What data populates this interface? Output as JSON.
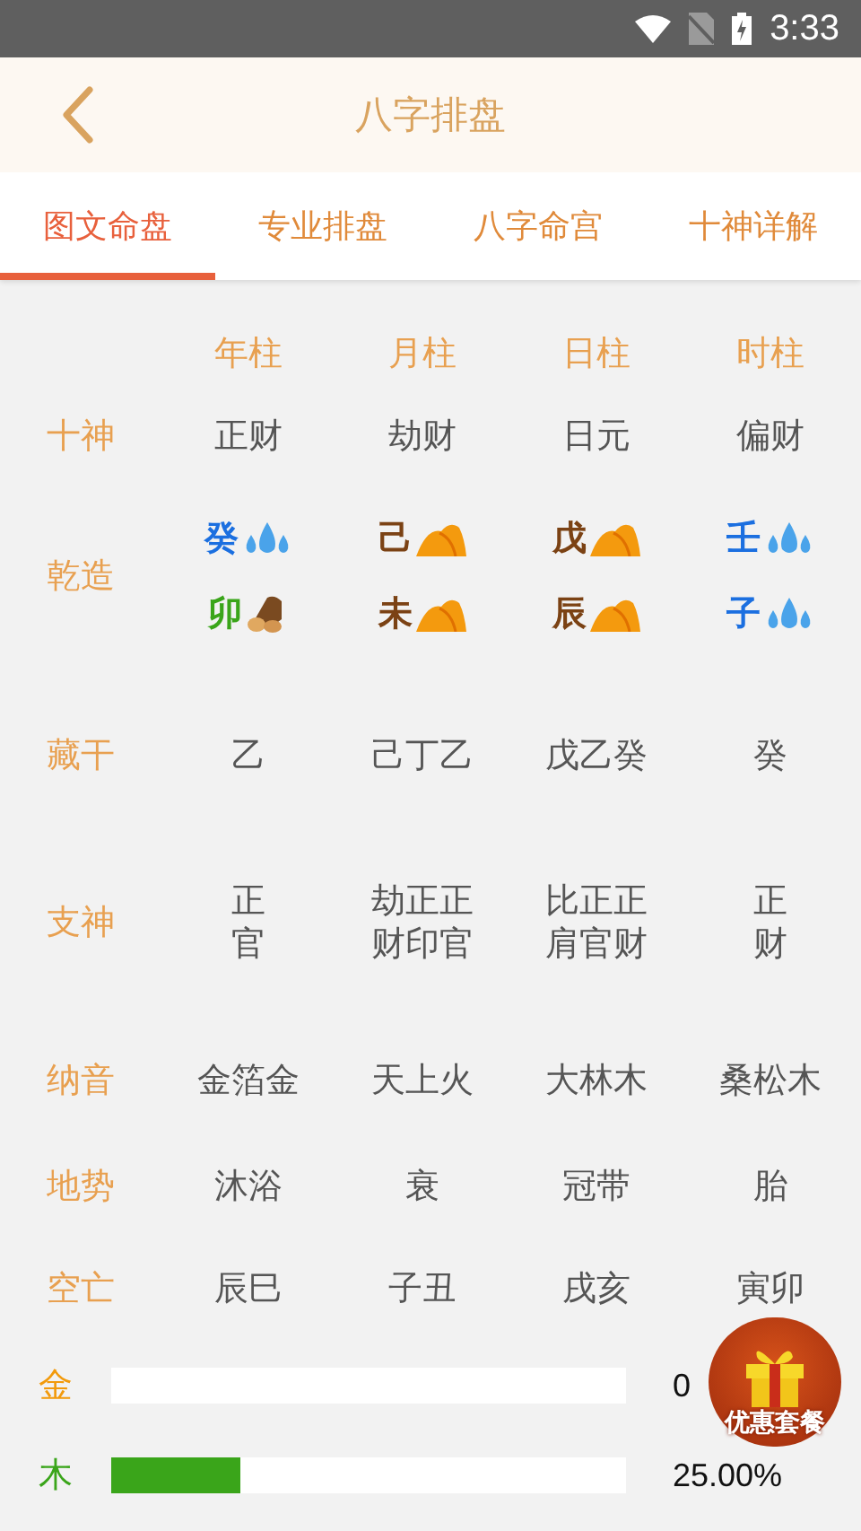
{
  "status_bar": {
    "time": "3:33"
  },
  "header": {
    "title": "八字排盘"
  },
  "tabs": [
    {
      "label": "图文命盘",
      "selected": true
    },
    {
      "label": "专业排盘",
      "selected": false
    },
    {
      "label": "八字命宫",
      "selected": false
    },
    {
      "label": "十神详解",
      "selected": false
    }
  ],
  "columns": [
    "年柱",
    "月柱",
    "日柱",
    "时柱"
  ],
  "shishen": {
    "label": "十神",
    "values": [
      "正财",
      "劫财",
      "日元",
      "偏财"
    ]
  },
  "qianzao": {
    "label": "乾造",
    "stems": [
      {
        "char": "癸",
        "kind": "water",
        "color": "#1b6fe0"
      },
      {
        "char": "己",
        "kind": "earth",
        "color": "#7b4214"
      },
      {
        "char": "戊",
        "kind": "earth",
        "color": "#7b4214"
      },
      {
        "char": "壬",
        "kind": "water",
        "color": "#1b6fe0"
      }
    ],
    "branches": [
      {
        "char": "卯",
        "kind": "wood",
        "color": "#3aa51a"
      },
      {
        "char": "未",
        "kind": "earth",
        "color": "#7b4214"
      },
      {
        "char": "辰",
        "kind": "earth",
        "color": "#7b4214"
      },
      {
        "char": "子",
        "kind": "water",
        "color": "#1b6fe0"
      }
    ]
  },
  "rows": [
    {
      "label": "藏干",
      "kind": "plain",
      "values": [
        "乙",
        "己丁乙",
        "戊乙癸",
        "癸"
      ]
    },
    {
      "label": "支神",
      "kind": "stacked",
      "values": [
        "正官",
        "劫正正财印官",
        "比正正肩官财",
        "正财"
      ]
    },
    {
      "label": "纳音",
      "kind": "plain",
      "values": [
        "金箔金",
        "天上火",
        "大林木",
        "桑松木"
      ]
    },
    {
      "label": "地势",
      "kind": "plain",
      "values": [
        "沐浴",
        "衰",
        "冠带",
        "胎"
      ]
    },
    {
      "label": "空亡",
      "kind": "plain",
      "values": [
        "辰巳",
        "子丑",
        "戌亥",
        "寅卯"
      ]
    }
  ],
  "elements": [
    {
      "label": "金",
      "color": "#f29a0c",
      "level": 0,
      "percent": "0"
    },
    {
      "label": "木",
      "color": "#3aa51a",
      "level": 0.25,
      "percent": "25.00%"
    }
  ],
  "promo_badge": {
    "label": "优惠套餐"
  }
}
